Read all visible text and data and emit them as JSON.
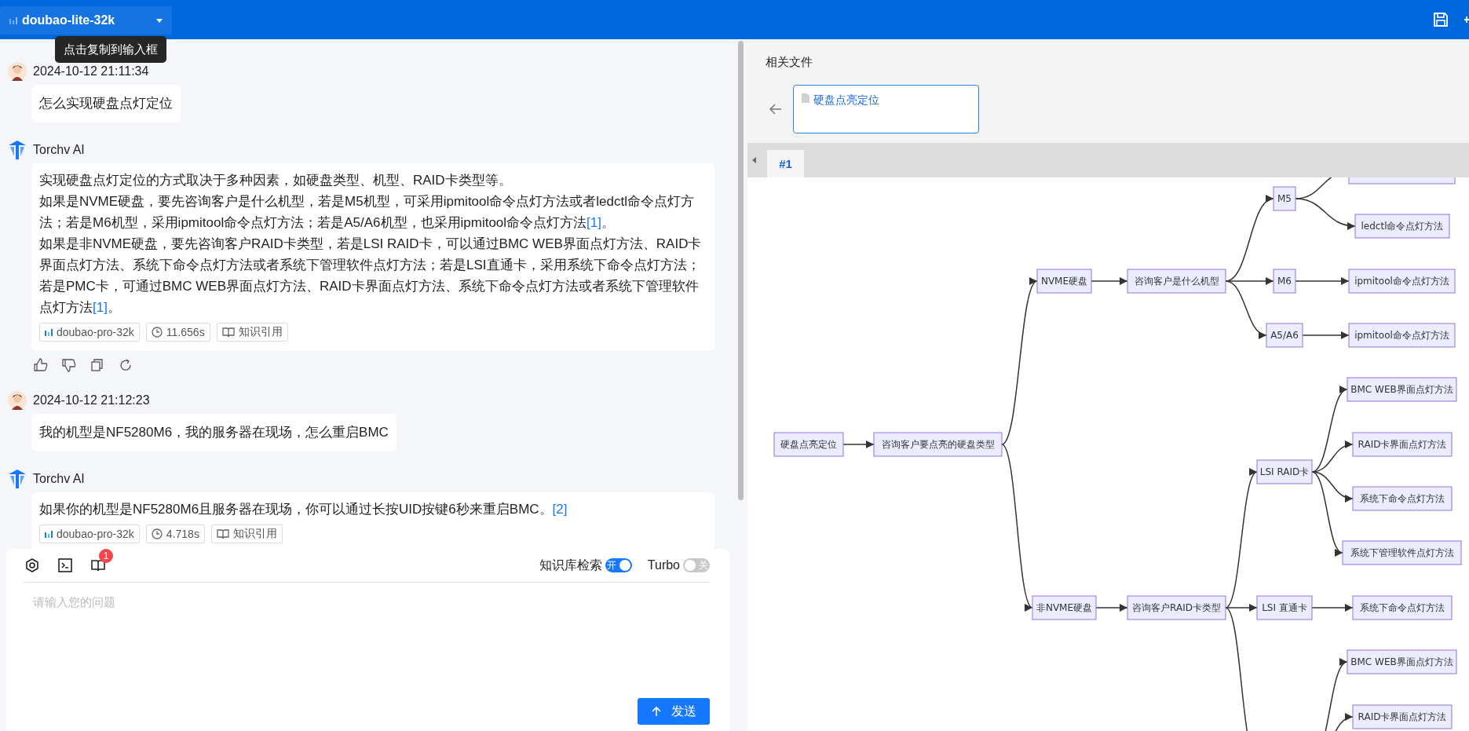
{
  "header": {
    "model": "doubao-lite-32k",
    "tooltip": "点击复制到输入框"
  },
  "messages": [
    {
      "kind": "question",
      "time": "2024-10-12 21:11:34",
      "text": "怎么实现硬盘点灯定位"
    },
    {
      "kind": "answer",
      "sender": "Torchv AI",
      "paragraphs": [
        [
          {
            "kind": "text",
            "text": "实现硬盘点灯定位的方式取决于多种因素，如硬盘类型、机型、RAID卡类型等。"
          }
        ],
        [
          {
            "kind": "text",
            "text": "如果是NVME硬盘，要先咨询客户是什么机型，若是M5机型，可采用ipmitool命令点灯方法或者ledctl命令点灯方法；若是M6机型，采用ipmitool命令点灯方法；若是A5/A6机型，也采用ipmitool命令点灯方法"
          },
          {
            "kind": "link",
            "text": "[1]"
          },
          {
            "kind": "text",
            "text": "。"
          }
        ],
        [
          {
            "kind": "text",
            "text": "如果是非NVME硬盘，要先咨询客户RAID卡类型，若是LSI RAID卡，可以通过BMC WEB界面点灯方法、RAID卡界面点灯方法、系统下命令点灯方法或者系统下管理软件点灯方法；若是LSI直通卡，采用系统下命令点灯方法；若是PMC卡，可通过BMC WEB界面点灯方法、RAID卡界面点灯方法、系统下命令点灯方法或者系统下管理软件点灯方法"
          },
          {
            "kind": "link",
            "text": "[1]"
          },
          {
            "kind": "text",
            "text": "。"
          }
        ]
      ],
      "tags": [
        {
          "kind": "model",
          "text": "doubao-pro-32k"
        },
        {
          "kind": "time",
          "text": "11.656s"
        },
        {
          "kind": "refs",
          "text": "知识引用"
        }
      ],
      "actions": [
        {
          "kind": "like"
        },
        {
          "kind": "dislike"
        },
        {
          "kind": "copy"
        },
        {
          "kind": "regenerate"
        }
      ]
    },
    {
      "kind": "question",
      "time": "2024-10-12 21:12:23",
      "text": "我的机型是NF5280M6，我的服务器在现场，怎么重启BMC"
    },
    {
      "kind": "answer",
      "sender": "Torchv AI",
      "paragraphs": [
        [
          {
            "kind": "text",
            "text": "如果你的机型是NF5280M6且服务器在现场，你可以通过长按UID按键6秒来重启BMC。"
          },
          {
            "kind": "link",
            "text": "[2]"
          }
        ]
      ],
      "tags": [
        {
          "kind": "model",
          "text": "doubao-pro-32k"
        },
        {
          "kind": "time",
          "text": "4.718s"
        },
        {
          "kind": "refs",
          "text": "知识引用"
        }
      ]
    }
  ],
  "composer": {
    "tools": [
      {
        "kind": "plugin"
      },
      {
        "kind": "terminal"
      },
      {
        "kind": "book",
        "badge": "1"
      }
    ],
    "toggles": [
      {
        "label": "知识库检索",
        "on": true,
        "text": "开"
      },
      {
        "label": "Turbo",
        "on": false,
        "text": "关"
      }
    ],
    "placeholder": "请输入您的问题",
    "send": "发送"
  },
  "related": {
    "title": "相关文件",
    "files": [
      {
        "name": "硬盘点亮定位",
        "selected": true
      }
    ],
    "tabs": [
      {
        "label": "#1",
        "selected": true
      }
    ]
  },
  "diagram": {
    "root": {
      "label": "硬盘点亮定位",
      "children": [
        {
          "label": "咨询客户要点亮的硬盘类型",
          "children": [
            {
              "label": "NVME硬盘",
              "children": [
                {
                  "label": "咨询客户是什么机型",
                  "children": [
                    {
                      "label": "M5",
                      "children": [
                        {
                          "kind": "cut"
                        },
                        {
                          "label": "ledctl命令点灯方法"
                        }
                      ]
                    },
                    {
                      "label": "M6",
                      "children": [
                        {
                          "label": "ipmitool命令点灯方法"
                        }
                      ]
                    },
                    {
                      "label": "A5/A6",
                      "children": [
                        {
                          "label": "ipmitool命令点灯方法"
                        }
                      ]
                    }
                  ]
                }
              ]
            },
            {
              "label": "非NVME硬盘",
              "children": [
                {
                  "label": "咨询客户RAID卡类型",
                  "children": [
                    {
                      "label": "LSI RAID卡",
                      "children": [
                        {
                          "label": "BMC WEB界面点灯方法"
                        },
                        {
                          "label": "RAID卡界面点灯方法"
                        },
                        {
                          "label": "系统下命令点灯方法"
                        },
                        {
                          "label": "系统下管理软件点灯方法"
                        }
                      ]
                    },
                    {
                      "label": "LSI 直通卡",
                      "children": [
                        {
                          "label": "系统下命令点灯方法"
                        }
                      ]
                    },
                    {
                      "kind": "cut",
                      "children": [
                        {
                          "label": "BMC WEB界面点灯方法"
                        },
                        {
                          "label": "RAID卡界面点灯方法"
                        }
                      ]
                    }
                  ]
                }
              ]
            }
          ]
        }
      ]
    }
  }
}
